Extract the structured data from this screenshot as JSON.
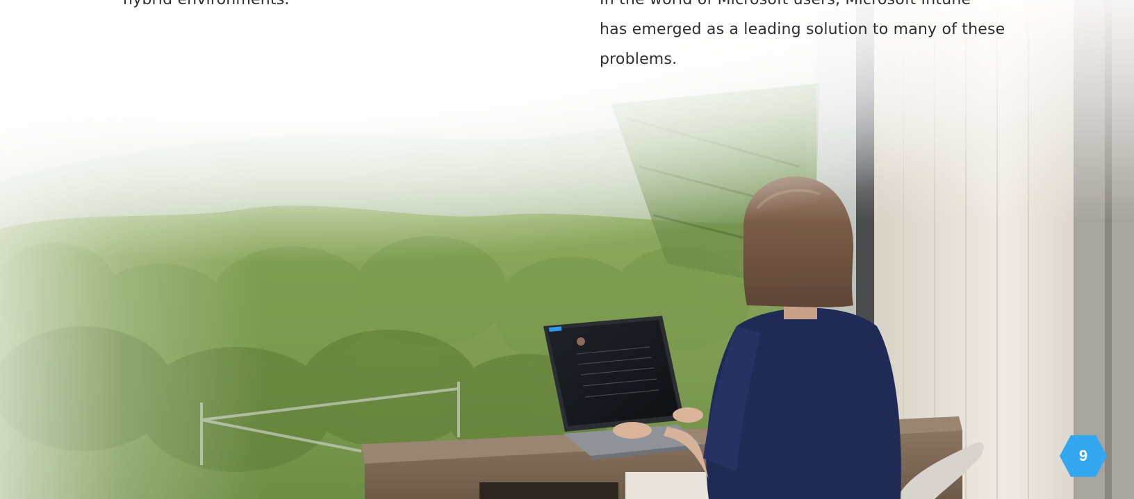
{
  "content": {
    "left_column_text": "hybrid environments.",
    "right_column_lines": [
      "In the world of Microsoft users, Microsoft Intune",
      "has emerged as a leading solution to many of these",
      "problems."
    ]
  },
  "page_number": "9",
  "colors": {
    "badge": "#33a8f0",
    "text": "#2f2f2f"
  }
}
